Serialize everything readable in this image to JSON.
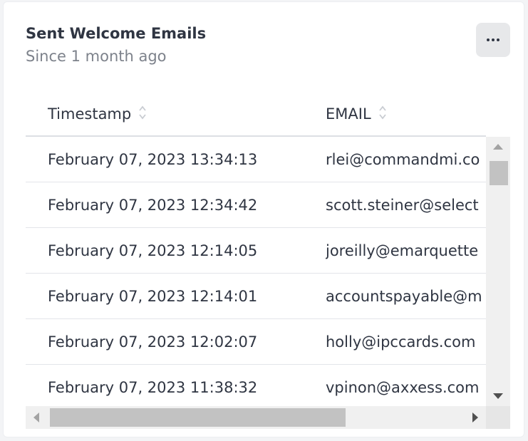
{
  "card": {
    "title": "Sent Welcome Emails",
    "subtitle": "Since 1 month ago",
    "more_icon": "ellipsis-icon"
  },
  "table": {
    "columns": [
      {
        "label": "Timestamp",
        "sort_icon": "sort-icon"
      },
      {
        "label": "EMAIL",
        "sort_icon": "sort-icon"
      }
    ],
    "rows": [
      {
        "timestamp": "February 07, 2023 13:34:13",
        "email": "rlei@commandmi.co"
      },
      {
        "timestamp": "February 07, 2023 12:34:42",
        "email": "scott.steiner@select"
      },
      {
        "timestamp": "February 07, 2023 12:14:05",
        "email": "joreilly@emarquette"
      },
      {
        "timestamp": "February 07, 2023 12:14:01",
        "email": "accountspayable@m"
      },
      {
        "timestamp": "February 07, 2023 12:02:07",
        "email": "holly@ipccards.com"
      },
      {
        "timestamp": "February 07, 2023 11:38:32",
        "email": "vpinon@axxess.com"
      }
    ]
  },
  "colors": {
    "text": "#2f3542",
    "muted": "#7d828b",
    "scrollbar_thumb": "#c2c2c2",
    "scrollbar_track": "#f0f0f0",
    "button_bg": "#e7e8ea"
  }
}
